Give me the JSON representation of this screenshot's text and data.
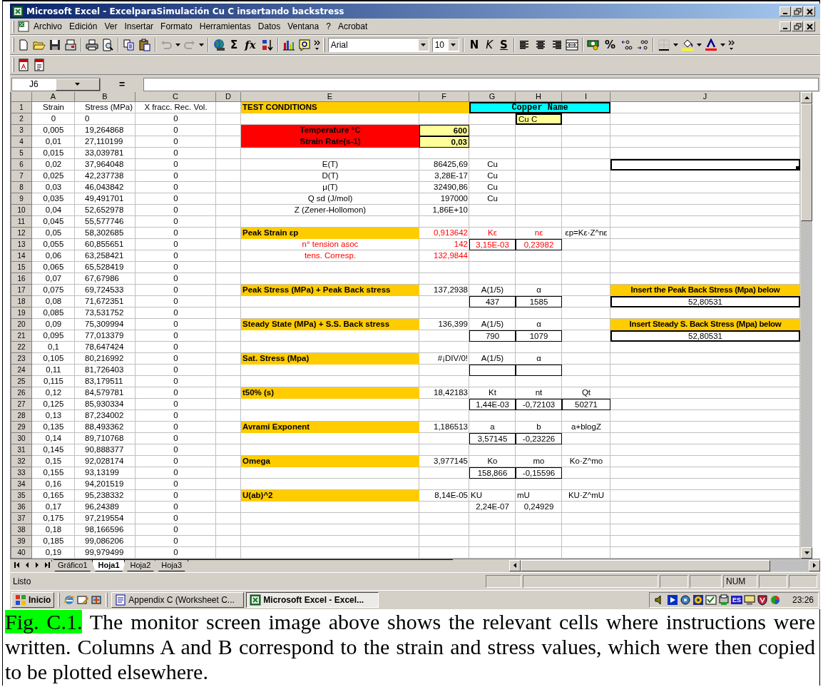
{
  "window": {
    "title": "Microsoft Excel - ExcelparaSimulación Cu C insertando backstress"
  },
  "menu": [
    "Archivo",
    "Edición",
    "Ver",
    "Insertar",
    "Formato",
    "Herramientas",
    "Datos",
    "Ventana",
    "?",
    "Acrobat"
  ],
  "toolbar": {
    "sum": "Σ",
    "function": "fx",
    "font": "Arial",
    "size": "10",
    "style_buttons": [
      "N",
      "K",
      "S"
    ],
    "percent": "%"
  },
  "formula_bar": {
    "name_box": "J6",
    "equals": "="
  },
  "sheet": {
    "columns": [
      "A",
      "B",
      "C",
      "D",
      "E",
      "F",
      "G",
      "H",
      "I",
      "J"
    ],
    "rows": [
      {
        "n": "1",
        "cells": {
          "A": "Strain",
          "B": "Stress  (MPa)",
          "C": "X fracc. Rec. Vol.",
          "E": {
            "text": "TEST CONDITIONS",
            "kind": "title"
          },
          "G": {
            "text": "Copper Name",
            "kind": "cyan-title"
          }
        }
      },
      {
        "n": "2",
        "cells": {
          "A": "0",
          "B": "0",
          "C": "0",
          "H": {
            "text": "Cu C",
            "kind": "name"
          }
        }
      },
      {
        "n": "3",
        "cells": {
          "A": "0,005",
          "B": "19,264868",
          "C": "0",
          "E": {
            "text": "Temperature °C",
            "kind": "alert"
          },
          "F": {
            "text": "600",
            "kind": "input"
          }
        }
      },
      {
        "n": "4",
        "cells": {
          "A": "0,01",
          "B": "27,110199",
          "C": "0",
          "E": {
            "text": "Strain Rate(s-1)",
            "kind": "alert"
          },
          "F": {
            "text": "0,03",
            "kind": "input"
          }
        }
      },
      {
        "n": "5",
        "cells": {
          "A": "0,015",
          "B": "33,039781",
          "C": "0"
        }
      },
      {
        "n": "6",
        "cells": {
          "A": "0,02",
          "B": "37,964048",
          "C": "0",
          "E": "E(T)",
          "F": "86425,69",
          "G": "Cu",
          "J": {
            "kind": "active"
          }
        }
      },
      {
        "n": "7",
        "cells": {
          "A": "0,025",
          "B": "42,237738",
          "C": "0",
          "E": "D(T)",
          "F": "3,28E-17",
          "G": "Cu"
        }
      },
      {
        "n": "8",
        "cells": {
          "A": "0,03",
          "B": "46,043842",
          "C": "0",
          "E": "μ(T)",
          "F": "32490,86",
          "G": "Cu"
        }
      },
      {
        "n": "9",
        "cells": {
          "A": "0,035",
          "B": "49,491701",
          "C": "0",
          "E": "Q sd (J/mol)",
          "F": "197000",
          "G": "Cu"
        }
      },
      {
        "n": "10",
        "cells": {
          "A": "0,04",
          "B": "52,652978",
          "C": "0",
          "E": "Z (Zener-Hollomon)",
          "F": "1,86E+10"
        }
      },
      {
        "n": "11",
        "cells": {
          "A": "0,045",
          "B": "55,577746",
          "C": "0"
        }
      },
      {
        "n": "12",
        "cells": {
          "A": "0,05",
          "B": "58,302685",
          "C": "0",
          "E": {
            "text": "Peak Strain εp",
            "kind": "section"
          },
          "F": {
            "text": "0,913642",
            "kind": "red"
          },
          "G": {
            "text": "Kε",
            "kind": "red"
          },
          "H": {
            "text": "nε",
            "kind": "red"
          },
          "I": "εp=Kε·Z^nε"
        }
      },
      {
        "n": "13",
        "cells": {
          "A": "0,055",
          "B": "60,855651",
          "C": "0",
          "E": {
            "text": "n° tension asoc",
            "kind": "red"
          },
          "F": {
            "text": "142",
            "kind": "red"
          },
          "G": {
            "text": "3,15E-03",
            "kind": "red-boxed"
          },
          "H": {
            "text": "0,23982",
            "kind": "red-boxed"
          }
        }
      },
      {
        "n": "14",
        "cells": {
          "A": "0,06",
          "B": "63,258421",
          "C": "0",
          "E": {
            "text": "tens. Corresp.",
            "kind": "red"
          },
          "F": {
            "text": "132,9844",
            "kind": "red"
          }
        }
      },
      {
        "n": "15",
        "cells": {
          "A": "0,065",
          "B": "65,528419",
          "C": "0"
        }
      },
      {
        "n": "16",
        "cells": {
          "A": "0,07",
          "B": "67,67986",
          "C": "0"
        }
      },
      {
        "n": "17",
        "cells": {
          "A": "0,075",
          "B": "69,724533",
          "C": "0",
          "E": {
            "text": "Peak Stress (MPa) + Peak Back stress",
            "kind": "section"
          },
          "F": "137,2938",
          "G": "A(1/5)",
          "H": "α",
          "J": {
            "text": "Insert the Peak Back Stress (Mpa) below",
            "kind": "banner"
          }
        }
      },
      {
        "n": "18",
        "cells": {
          "A": "0,08",
          "B": "71,672351",
          "C": "0",
          "G": {
            "text": "437",
            "kind": "boxed"
          },
          "H": {
            "text": "1585",
            "kind": "boxed"
          },
          "J": {
            "text": "52,80531",
            "kind": "entry"
          }
        }
      },
      {
        "n": "19",
        "cells": {
          "A": "0,085",
          "B": "73,531752",
          "C": "0"
        }
      },
      {
        "n": "20",
        "cells": {
          "A": "0,09",
          "B": "75,309994",
          "C": "0",
          "E": {
            "text": "Steady State (MPa) + S.S. Back stress",
            "kind": "section"
          },
          "F": "136,399",
          "G": "A(1/5)",
          "H": "α",
          "J": {
            "text": "Insert Steady S. Back Stress (Mpa) below",
            "kind": "banner"
          }
        }
      },
      {
        "n": "21",
        "cells": {
          "A": "0,095",
          "B": "77,013379",
          "C": "0",
          "G": {
            "text": "790",
            "kind": "boxed"
          },
          "H": {
            "text": "1079",
            "kind": "boxed"
          },
          "J": {
            "text": "52,80531",
            "kind": "entry"
          }
        }
      },
      {
        "n": "22",
        "cells": {
          "A": "0,1",
          "B": "78,647424",
          "C": "0"
        }
      },
      {
        "n": "23",
        "cells": {
          "A": "0,105",
          "B": "80,216992",
          "C": "0",
          "E": {
            "text": "Sat. Stress (Mpa)",
            "kind": "section"
          },
          "F": "#¡DIV/0!",
          "G": "A(1/5)",
          "H": "α"
        }
      },
      {
        "n": "24",
        "cells": {
          "A": "0,11",
          "B": "81,726403",
          "C": "0",
          "G": {
            "kind": "boxed"
          },
          "H": {
            "kind": "boxed"
          }
        }
      },
      {
        "n": "25",
        "cells": {
          "A": "0,115",
          "B": "83,179511",
          "C": "0"
        }
      },
      {
        "n": "26",
        "cells": {
          "A": "0,12",
          "B": "84,579781",
          "C": "0",
          "E": {
            "text": "t50% (s)",
            "kind": "section"
          },
          "F": "18,42183",
          "G": "Kt",
          "H": "nt",
          "I": "Qt"
        }
      },
      {
        "n": "27",
        "cells": {
          "A": "0,125",
          "B": "85,930334",
          "C": "0",
          "G": {
            "text": "1,44E-03",
            "kind": "boxed"
          },
          "H": {
            "text": "-0,72103",
            "kind": "boxed"
          },
          "I": {
            "text": "50271",
            "kind": "boxed"
          }
        }
      },
      {
        "n": "28",
        "cells": {
          "A": "0,13",
          "B": "87,234002",
          "C": "0"
        }
      },
      {
        "n": "29",
        "cells": {
          "A": "0,135",
          "B": "88,493362",
          "C": "0",
          "E": {
            "text": "Avrami Exponent",
            "kind": "section"
          },
          "F": "1,186513",
          "G": "a",
          "H": "b",
          "I": "a+blogZ"
        }
      },
      {
        "n": "30",
        "cells": {
          "A": "0,14",
          "B": "89,710768",
          "C": "0",
          "G": {
            "text": "3,57145",
            "kind": "boxed"
          },
          "H": {
            "text": "-0,23226",
            "kind": "boxed"
          }
        }
      },
      {
        "n": "31",
        "cells": {
          "A": "0,145",
          "B": "90,888377",
          "C": "0"
        }
      },
      {
        "n": "32",
        "cells": {
          "A": "0,15",
          "B": "92,028174",
          "C": "0",
          "E": {
            "text": "Omega",
            "kind": "section"
          },
          "F": "3,977145",
          "G": "Ko",
          "H": "mo",
          "I": "Ko·Z^mo"
        }
      },
      {
        "n": "33",
        "cells": {
          "A": "0,155",
          "B": "93,13199",
          "C": "0",
          "G": {
            "text": "158,866",
            "kind": "boxed"
          },
          "H": {
            "text": "-0,15596",
            "kind": "boxed"
          }
        }
      },
      {
        "n": "34",
        "cells": {
          "A": "0,16",
          "B": "94,201519",
          "C": "0"
        }
      },
      {
        "n": "35",
        "cells": {
          "A": "0,165",
          "B": "95,238332",
          "C": "0",
          "E": {
            "text": "U(ab)^2",
            "kind": "section"
          },
          "F": "8,14E-05",
          "G": {
            "text": "KU",
            "kind": "left"
          },
          "H": {
            "text": "mU",
            "kind": "left"
          },
          "I": "KU·Z^mU"
        }
      },
      {
        "n": "36",
        "cells": {
          "A": "0,17",
          "B": "96,24389",
          "C": "0",
          "G": "2,24E-07",
          "H": "0,24929"
        }
      },
      {
        "n": "37",
        "cells": {
          "A": "0,175",
          "B": "97,219554",
          "C": "0"
        }
      },
      {
        "n": "38",
        "cells": {
          "A": "0,18",
          "B": "98,166596",
          "C": "0"
        }
      },
      {
        "n": "39",
        "cells": {
          "A": "0,185",
          "B": "99,086206",
          "C": "0"
        }
      },
      {
        "n": "40",
        "cells": {
          "A": "0,19",
          "B": "99,979499",
          "C": "0"
        }
      }
    ]
  },
  "sheet_tabs": [
    {
      "label": "Gráfico1",
      "selected": false
    },
    {
      "label": "Hoja1",
      "selected": true
    },
    {
      "label": "Hoja2",
      "selected": false
    },
    {
      "label": "Hoja3",
      "selected": false
    }
  ],
  "status_bar": {
    "text": "Listo",
    "indicators": [
      "NUM"
    ]
  },
  "taskbar": {
    "start": "Inicio",
    "tasks": [
      {
        "label": "Appendix C (Worksheet C...",
        "kind": "document",
        "selected": false
      },
      {
        "label": "Microsoft Excel - Excel...",
        "kind": "spreadsheet",
        "selected": true
      }
    ],
    "tray_language": "ES",
    "clock": "23:26"
  },
  "caption": {
    "label": "Fig. C.1.",
    "text": "The monitor screen image above shows the relevant cells where instructions were written. Columns A and B correspond to the strain and stress values, which were then copied to be plotted elsewhere."
  }
}
